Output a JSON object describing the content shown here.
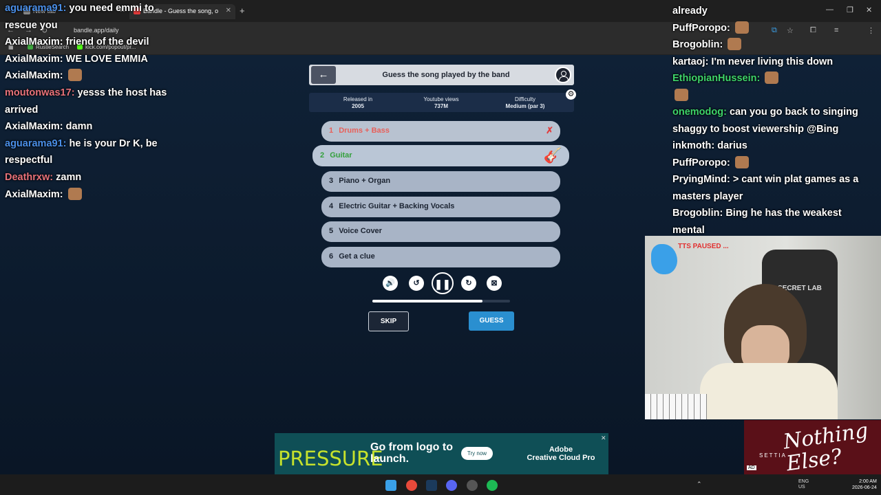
{
  "browser": {
    "tabs": [
      {
        "label": "New tab"
      },
      {
        "label": "Bandle - Guess the song, o"
      }
    ],
    "url": "bandle.app/daily",
    "bookmarks": [
      "RustleSearch",
      "kick.com/popout/pr..."
    ]
  },
  "chat_left": [
    {
      "user": "aguarama91",
      "color": "#4a8fe8",
      "text": "you need emmi to"
    },
    {
      "user": "",
      "color": "#ffffff",
      "text": "rescue you"
    },
    {
      "user": "AxialMaxim",
      "color": "#ffffff",
      "text": "friend of the devil"
    },
    {
      "user": "AxialMaxim",
      "color": "#ffffff",
      "text": "WE LOVE EMMIA"
    },
    {
      "user": "AxialMaxim",
      "color": "#ffffff",
      "text": ""
    },
    {
      "user": "moutonwas17",
      "color": "#e8727a",
      "text": "yesss the host has"
    },
    {
      "user": "",
      "color": "#ffffff",
      "text": "arrived"
    },
    {
      "user": "AxialMaxim",
      "color": "#ffffff",
      "text": "damn"
    },
    {
      "user": "aguarama91",
      "color": "#4a8fe8",
      "text": "he is your Dr K, be"
    },
    {
      "user": "",
      "color": "#ffffff",
      "text": "respectful"
    },
    {
      "user": "Deathrxw",
      "color": "#e8727a",
      "text": "zamn"
    },
    {
      "user": "AxialMaxim",
      "color": "#ffffff",
      "text": ""
    }
  ],
  "chat_right": [
    {
      "user": "",
      "color": "#ffffff",
      "text": "already"
    },
    {
      "user": "PuffPoropo",
      "color": "#ffffff",
      "text": ""
    },
    {
      "user": "Brogoblin",
      "color": "#ffffff",
      "text": ""
    },
    {
      "user": "kartaoj",
      "color": "#ffffff",
      "text": "I'm never living this down"
    },
    {
      "user": "EthiopianHussein",
      "color": "#3ed46a",
      "text": ""
    },
    {
      "user": "",
      "color": "#ffffff",
      "text": ""
    },
    {
      "user": "onemodog",
      "color": "#3ed46a",
      "text": "can you go back to singing"
    },
    {
      "user": "",
      "color": "#ffffff",
      "text": "shaggy to boost viewership @Bing"
    },
    {
      "user": "inkmoth",
      "color": "#ffffff",
      "text": "darius"
    },
    {
      "user": "PuffPoropo",
      "color": "#ffffff",
      "text": ""
    },
    {
      "user": "PryingMind",
      "color": "#ffffff",
      "text": "> cant win plat games as a"
    },
    {
      "user": "",
      "color": "#ffffff",
      "text": "masters player"
    },
    {
      "user": "Brogoblin",
      "color": "#ffffff",
      "text": "Bing he has the weakest mental"
    }
  ],
  "game": {
    "title": "Guess the song played by the band",
    "stats": [
      {
        "label": "Released in",
        "value": "2005"
      },
      {
        "label": "Youtube views",
        "value": "737M"
      },
      {
        "label": "Difficulty",
        "value": "Medium (par 3)"
      }
    ],
    "rows": [
      {
        "num": "1",
        "label": "Drums + Bass",
        "state": "failed"
      },
      {
        "num": "2",
        "label": "Guitar",
        "state": "current"
      },
      {
        "num": "3",
        "label": "Piano + Organ",
        "state": "locked"
      },
      {
        "num": "4",
        "label": "Electric Guitar + Backing Vocals",
        "state": "locked"
      },
      {
        "num": "5",
        "label": "Voice Cover",
        "state": "locked"
      },
      {
        "num": "6",
        "label": "Get a clue",
        "state": "locked"
      }
    ],
    "progress": 0.8,
    "skip_label": "SKIP",
    "guess_label": "GUESS"
  },
  "ad": {
    "brand": "PRESSURE",
    "headline": "Go from logo to launch.",
    "cta": "Try now",
    "sponsor_line1": "Adobe",
    "sponsor_line2": "Creative Cloud Pro"
  },
  "overlay": {
    "tts_status": "TTS PAUSED ...",
    "chair_brand": "SECRET LAB",
    "song_ad_title": "Nothing Else?",
    "song_ad_artist": "SETTIA",
    "song_ad_tag": "AD"
  },
  "taskbar": {
    "lang": "ENG",
    "region": "US",
    "time": "2:00 AM",
    "date": "2026-06-24"
  }
}
